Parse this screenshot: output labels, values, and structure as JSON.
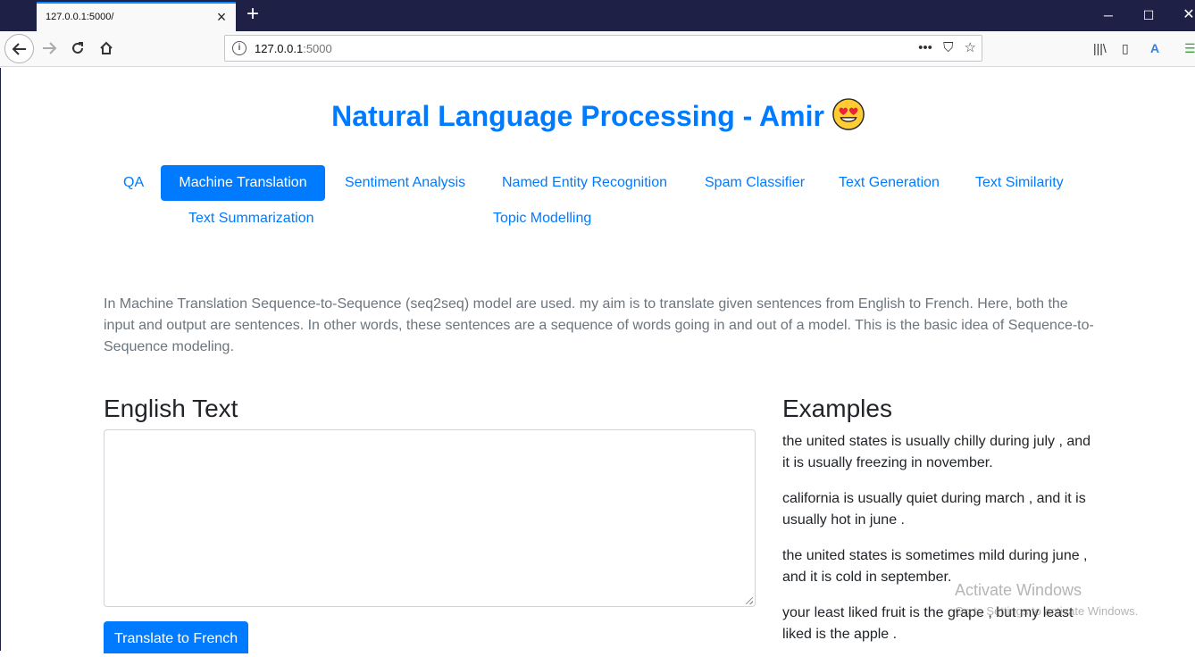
{
  "browser": {
    "tab_title": "127.0.0.1:5000/",
    "url_host": "127.0.0.1",
    "url_port": ":5000"
  },
  "page": {
    "title": "Natural Language Processing - Amir",
    "nav": [
      {
        "label": "QA",
        "active": false
      },
      {
        "label": "Machine Translation",
        "active": true
      },
      {
        "label": "Sentiment Analysis",
        "active": false
      },
      {
        "label": "Named Entity Recognition",
        "active": false
      },
      {
        "label": "Spam Classifier",
        "active": false
      },
      {
        "label": "Text Generation",
        "active": false
      },
      {
        "label": "Text Similarity",
        "active": false
      },
      {
        "label": "Text Summarization",
        "active": false
      },
      {
        "label": "Topic Modelling",
        "active": false
      }
    ],
    "description": "In Machine Translation Sequence-to-Sequence (seq2seq) model are used. my aim is to translate given sentences from English to French. Here, both the input and output are sentences. In other words, these sentences are a sequence of words going in and out of a model. This is the basic idea of Sequence-to-Sequence modeling.",
    "input_heading": "English Text",
    "input_value": "",
    "translate_button": "Translate to French",
    "examples_heading": "Examples",
    "examples": [
      "the united states is usually chilly during july , and it is usually freezing in november.",
      "california is usually quiet during march , and it is usually hot in june .",
      "the united states is sometimes mild during june , and it is cold in september.",
      "your least liked fruit is the grape , but my least liked is the apple ."
    ]
  },
  "watermark": {
    "line1": "Activate Windows",
    "line2": "Go to Settings to activate Windows."
  },
  "colors": {
    "accent": "#007bff",
    "titlebar": "#1e2145"
  }
}
